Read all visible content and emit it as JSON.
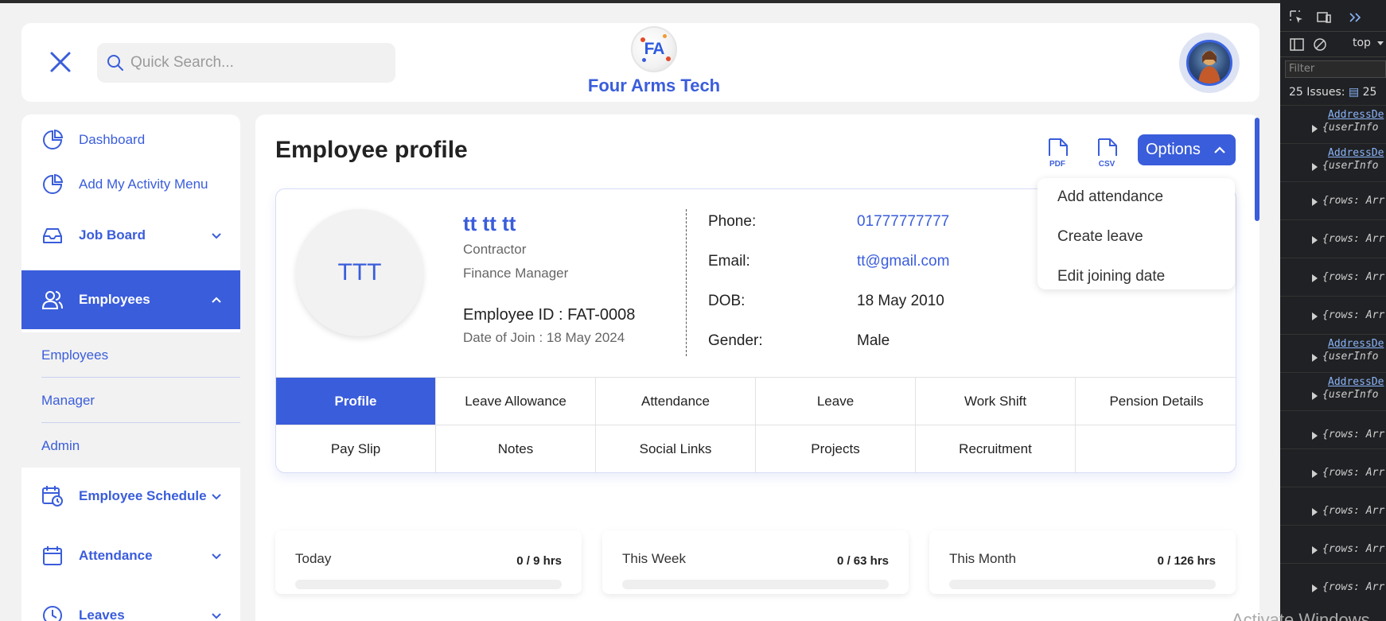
{
  "header": {
    "search_placeholder": "Quick Search...",
    "logo_mark": "FA",
    "company_name": "Four Arms Tech"
  },
  "sidebar": {
    "items": [
      {
        "label": "Dashboard",
        "icon": "pie-chart-icon"
      },
      {
        "label": "Add My Activity Menu",
        "icon": "pie-chart-icon"
      },
      {
        "label": "Job Board",
        "icon": "inbox-icon",
        "expandable": true
      },
      {
        "label": "Employees",
        "icon": "users-icon",
        "expanded": true,
        "active": true
      },
      {
        "label": "Employee Schedule",
        "icon": "calendar-clock-icon",
        "expandable": true
      },
      {
        "label": "Attendance",
        "icon": "calendar-icon",
        "expandable": true
      },
      {
        "label": "Leaves",
        "icon": "clock-icon",
        "expandable": true
      }
    ],
    "submenu": [
      "Employees",
      "Manager",
      "Admin"
    ]
  },
  "page": {
    "title": "Employee profile",
    "pdf_label": "PDF",
    "csv_label": "CSV",
    "options_label": "Options",
    "options_menu": [
      "Add attendance",
      "Create leave",
      "Edit joining date"
    ]
  },
  "profile": {
    "initials": "TTT",
    "name": "tt tt tt",
    "employment_type": "Contractor",
    "role": "Finance Manager",
    "employee_id": "Employee ID : FAT-0008",
    "date_of_join": "Date of Join : 18 May 2024",
    "fields": [
      {
        "label": "Phone:",
        "value": "01777777777",
        "link": true
      },
      {
        "label": "Email:",
        "value": "tt@gmail.com",
        "link": true
      },
      {
        "label": "DOB:",
        "value": "18 May 2010",
        "link": false
      },
      {
        "label": "Gender:",
        "value": "Male",
        "link": false
      }
    ]
  },
  "tabs": {
    "row1": [
      "Profile",
      "Leave Allowance",
      "Attendance",
      "Leave",
      "Work Shift",
      "Pension Details"
    ],
    "row2": [
      "Pay Slip",
      "Notes",
      "Social Links",
      "Projects",
      "Recruitment"
    ],
    "active": "Profile"
  },
  "stats": [
    {
      "title": "Today",
      "value": "0 / 9 hrs",
      "progress": 0
    },
    {
      "title": "This Week",
      "value": "0 / 63 hrs",
      "progress": 0
    },
    {
      "title": "This Month",
      "value": "0 / 126 hrs",
      "progress": 0
    }
  ],
  "devtools": {
    "context": "top",
    "filter_placeholder": "Filter",
    "issues_label": "25 Issues:",
    "issues_count": "25",
    "link_text": "AddressDe",
    "user_info": "{userInfo",
    "rows_text": "{rows: Arr"
  },
  "watermark": "Activate Windows",
  "colors": {
    "accent": "#3a5ddb",
    "background": "#f2f2f2"
  }
}
